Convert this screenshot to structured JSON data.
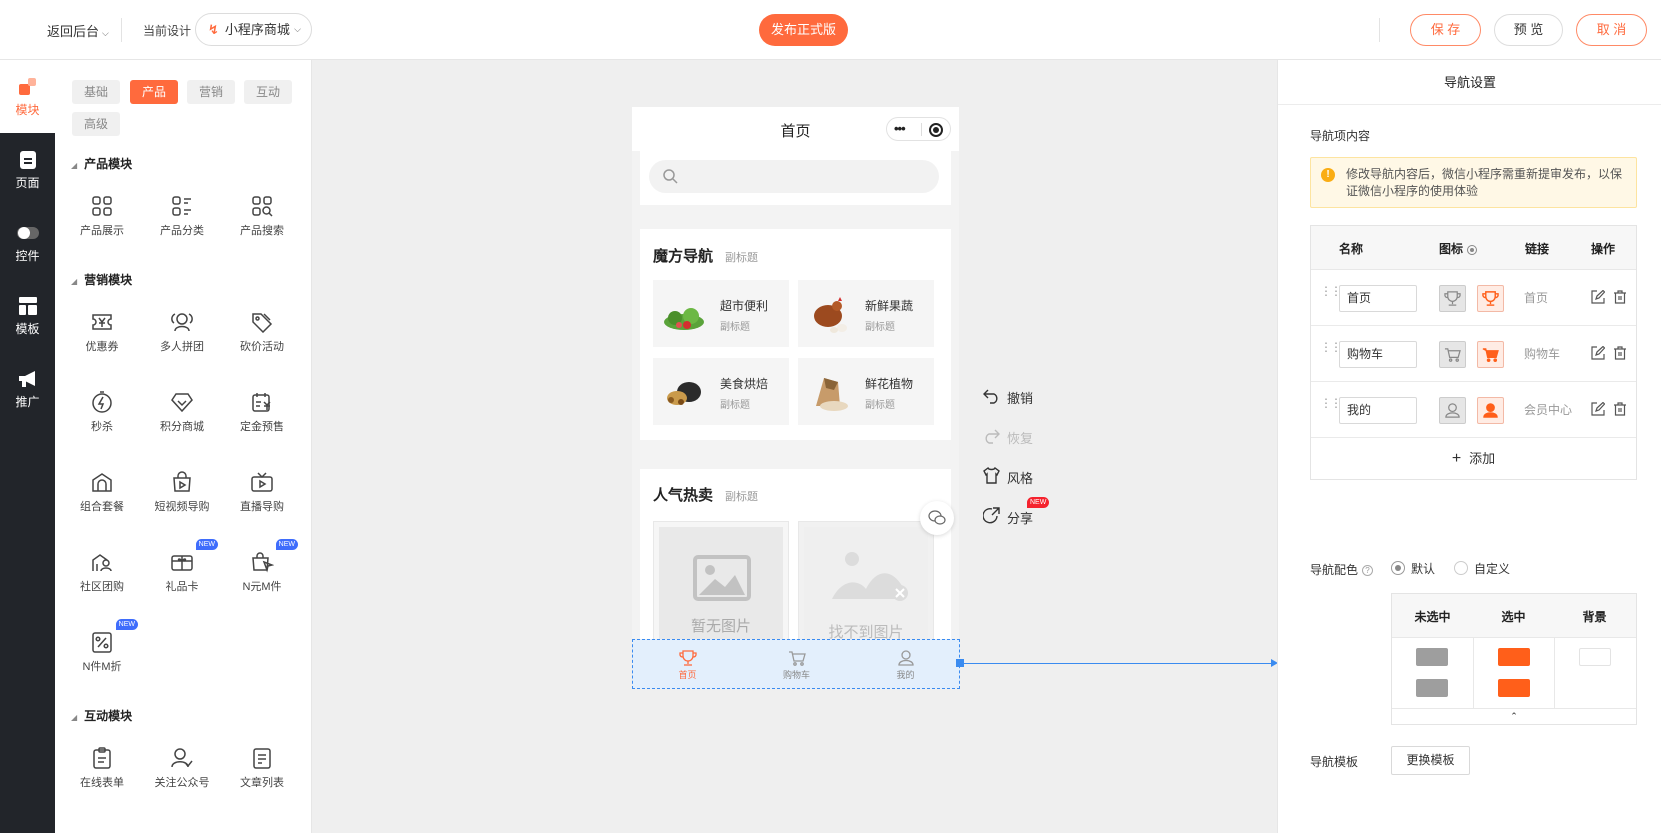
{
  "topbar": {
    "back_label": "返回后台",
    "current_design_label": "当前设计",
    "design_select_value": "小程序商城",
    "publish_label": "发布正式版",
    "save_label": "保 存",
    "preview_label": "预 览",
    "cancel_label": "取 消"
  },
  "leftnav": {
    "items": [
      {
        "label": "模块",
        "icon": "modules-icon"
      },
      {
        "label": "页面",
        "icon": "page-icon"
      },
      {
        "label": "控件",
        "icon": "toggle-icon"
      },
      {
        "label": "模板",
        "icon": "template-icon"
      },
      {
        "label": "推广",
        "icon": "megaphone-icon"
      }
    ]
  },
  "modpanel": {
    "tabs": [
      "基础",
      "产品",
      "营销",
      "互动",
      "高级"
    ],
    "active_tab": "产品",
    "sections": [
      {
        "title": "产品模块",
        "items": [
          {
            "label": "产品展示",
            "icon": "grid-icon"
          },
          {
            "label": "产品分类",
            "icon": "category-list-icon"
          },
          {
            "label": "产品搜索",
            "icon": "grid-search-icon"
          }
        ]
      },
      {
        "title": "营销模块",
        "items": [
          {
            "label": "优惠券",
            "icon": "coupon-icon"
          },
          {
            "label": "多人拼团",
            "icon": "group-buy-icon"
          },
          {
            "label": "砍价活动",
            "icon": "bargain-tag-icon"
          },
          {
            "label": "秒杀",
            "icon": "flash-sale-icon"
          },
          {
            "label": "积分商城",
            "icon": "diamond-icon"
          },
          {
            "label": "定金预售",
            "icon": "presale-icon"
          },
          {
            "label": "组合套餐",
            "icon": "combo-bag-icon"
          },
          {
            "label": "短视频导购",
            "icon": "video-bag-icon"
          },
          {
            "label": "直播导购",
            "icon": "live-tv-icon"
          },
          {
            "label": "社区团购",
            "icon": "community-icon"
          },
          {
            "label": "礼品卡",
            "icon": "gift-card-icon",
            "badge": "NEW"
          },
          {
            "label": "N元M件",
            "icon": "bag-cursor-icon",
            "badge": "NEW"
          },
          {
            "label": "N件M折",
            "icon": "discount-icon",
            "badge": "NEW"
          }
        ]
      },
      {
        "title": "互动模块",
        "items": [
          {
            "label": "在线表单",
            "icon": "form-icon"
          },
          {
            "label": "关注公众号",
            "icon": "follow-user-icon"
          },
          {
            "label": "文章列表",
            "icon": "article-icon"
          }
        ]
      }
    ]
  },
  "phone": {
    "title": "首页",
    "magic_nav": {
      "title": "魔方导航",
      "subtitle": "副标题",
      "cells": [
        {
          "name": "超市便利",
          "sub": "副标题"
        },
        {
          "name": "新鲜果蔬",
          "sub": "副标题"
        },
        {
          "name": "美食烘焙",
          "sub": "副标题"
        },
        {
          "name": "鲜花植物",
          "sub": "副标题"
        }
      ]
    },
    "hot": {
      "title": "人气热卖",
      "subtitle": "副标题",
      "products": [
        "暂无图片",
        "找不到图片"
      ]
    },
    "tabbar": [
      {
        "label": "首页",
        "icon": "trophy-icon"
      },
      {
        "label": "购物车",
        "icon": "cart-icon"
      },
      {
        "label": "我的",
        "icon": "user-icon"
      }
    ]
  },
  "actions": {
    "undo": "撤销",
    "redo": "恢复",
    "style": "风格",
    "share": "分享",
    "share_badge": "NEW"
  },
  "rpanel": {
    "title": "导航设置",
    "content_label": "导航项内容",
    "warning": "修改导航内容后，微信小程序需重新提审发布，以保证微信小程序的使用体验",
    "table_headers": [
      "名称",
      "图标",
      "链接",
      "操作"
    ],
    "rows": [
      {
        "name": "首页",
        "link": "首页",
        "icon": "trophy-icon"
      },
      {
        "name": "购物车",
        "link": "购物车",
        "icon": "cart-icon"
      },
      {
        "name": "我的",
        "link": "会员中心",
        "icon": "user-icon"
      }
    ],
    "add_label": "添加",
    "color_label": "导航配色",
    "color_options": [
      "默认",
      "自定义"
    ],
    "color_selected": "默认",
    "color_headers": [
      "未选中",
      "选中",
      "背景"
    ],
    "colors": {
      "unselected": "#9e9e9e",
      "selected": "#ff5f1a",
      "background": "#ffffff",
      "accent": "#ff6a3d",
      "selection_blue": "#3a8bf0"
    },
    "template_label": "导航模板",
    "template_button": "更换模板"
  }
}
